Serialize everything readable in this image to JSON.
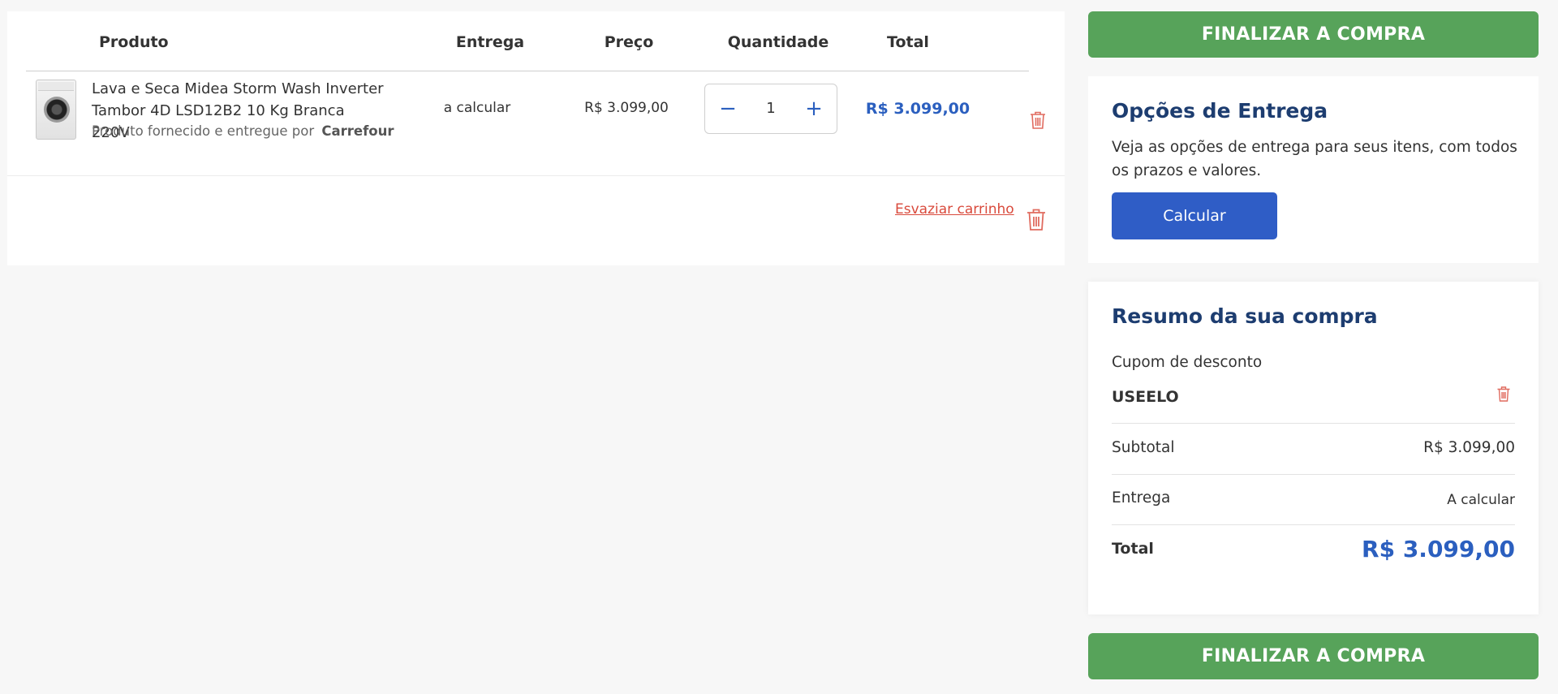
{
  "table": {
    "headers": {
      "product": "Produto",
      "delivery": "Entrega",
      "price": "Preço",
      "quantity": "Quantidade",
      "total": "Total"
    },
    "items": [
      {
        "name": "Lava e Seca Midea Storm Wash Inverter Tambor 4D LSD12B2 10 Kg Branca 220V",
        "seller_prefix": "Produto fornecido e entregue por",
        "seller": "Carrefour",
        "delivery": "a calcular",
        "price": "R$ 3.099,00",
        "quantity": "1",
        "total": "R$ 3.099,00"
      }
    ],
    "empty_cart_label": "Esvaziar carrinho",
    "qty_minus": "−",
    "qty_plus": "+"
  },
  "checkout_label": "FINALIZAR A COMPRA",
  "delivery_options": {
    "title": "Opções de Entrega",
    "description": "Veja as opções de entrega para seus itens, com todos os prazos e valores.",
    "button_label": "Calcular"
  },
  "summary": {
    "title": "Resumo da sua compra",
    "coupon_label": "Cupom de desconto",
    "coupon_code": "USEELO",
    "subtotal_label": "Subtotal",
    "subtotal_value": "R$ 3.099,00",
    "delivery_label": "Entrega",
    "delivery_value": "A calcular",
    "total_label": "Total",
    "total_value": "R$ 3.099,00"
  },
  "colors": {
    "checkout_green": "#57a35a",
    "action_blue": "#2f5dc6",
    "price_blue": "#2b5fbf",
    "title_navy": "#1d3d70",
    "danger_red": "#d94a3c"
  },
  "icons": {
    "remove_item": "trash-icon",
    "empty_cart": "trash-icon",
    "remove_coupon": "trash-icon",
    "product_image": "washing-machine-thumbnail"
  }
}
